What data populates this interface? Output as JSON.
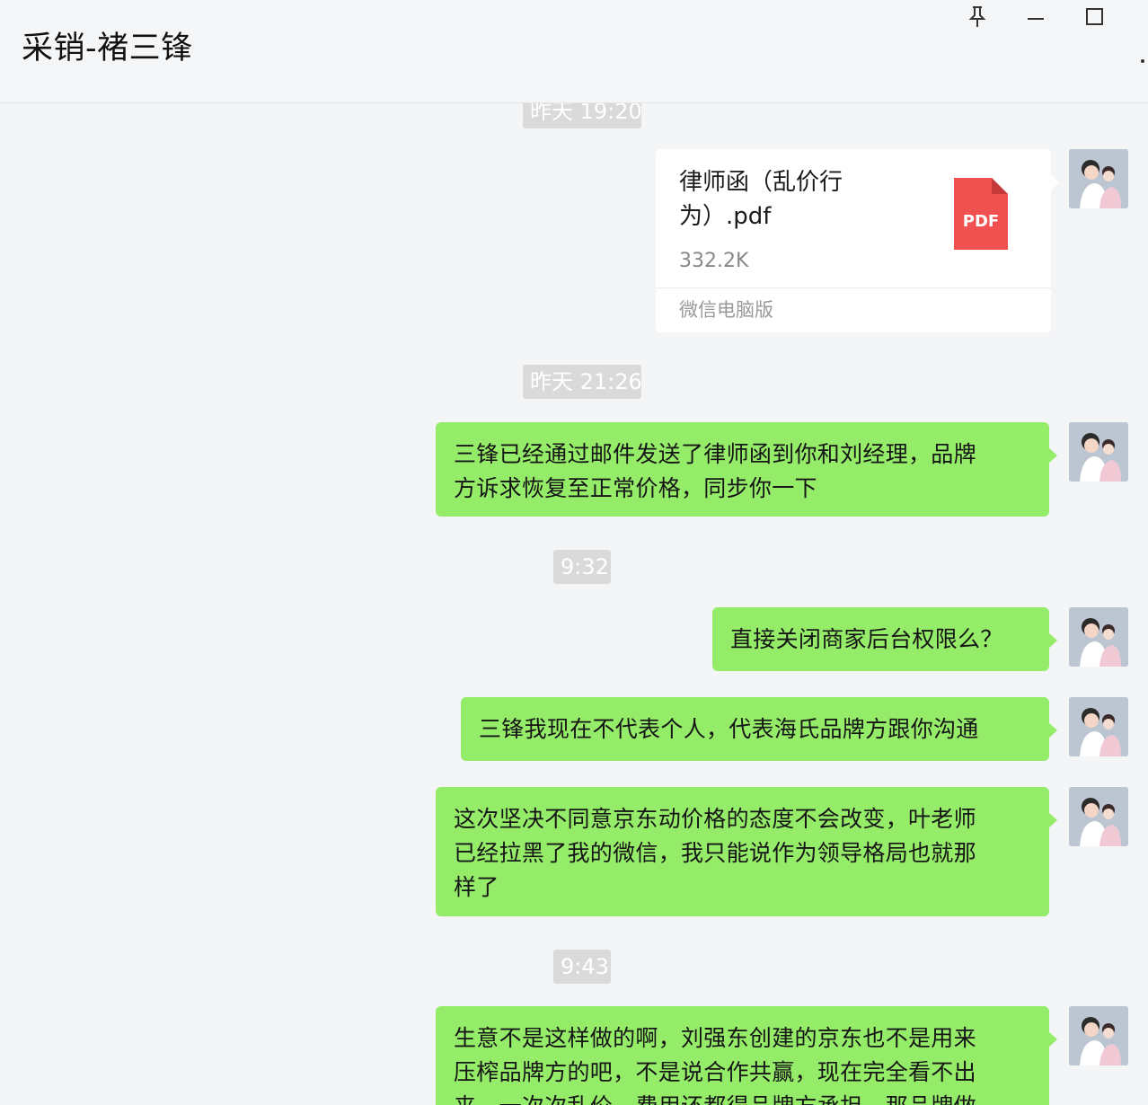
{
  "window": {
    "title": "采销-褚三锋",
    "controls": {
      "pin_icon": "pin-icon",
      "minimize_icon": "minimize-icon",
      "maximize_icon": "maximize-icon"
    }
  },
  "messages": {
    "timestamp_1": "昨天 19:20",
    "file": {
      "name_line1": "律师函（乱价行",
      "name_line2": "为）.pdf",
      "size": "332.2K",
      "source": "微信电脑版",
      "icon_label": "PDF"
    },
    "timestamp_2": "昨天 21:26",
    "msg_1_line1": "三锋已经通过邮件发送了律师函到你和刘经理，品牌",
    "msg_1_line2": "方诉求恢复至正常价格，同步你一下",
    "timestamp_3": "9:32",
    "msg_2": "直接关闭商家后台权限么？",
    "msg_3": "三锋我现在不代表个人，代表海氏品牌方跟你沟通",
    "msg_4_line1": "这次坚决不同意京东动价格的态度不会改变，叶老师",
    "msg_4_line2": "已经拉黑了我的微信，我只能说作为领导格局也就那",
    "msg_4_line3": "样了",
    "timestamp_4": "9:43",
    "msg_5_line1": "生意不是这样做的啊，刘强东创建的京东也不是用来",
    "msg_5_line2": "压榨品牌方的吧，不是说合作共赢，现在完全看不出",
    "msg_5_line3": "来，一次次乱价，费用还都得品牌方承担，那品牌做"
  },
  "colors": {
    "bubble_green": "#95ec69",
    "background": "#f4f5f7",
    "timestamp_bg": "#dadada",
    "pdf_red": "#f05050"
  }
}
